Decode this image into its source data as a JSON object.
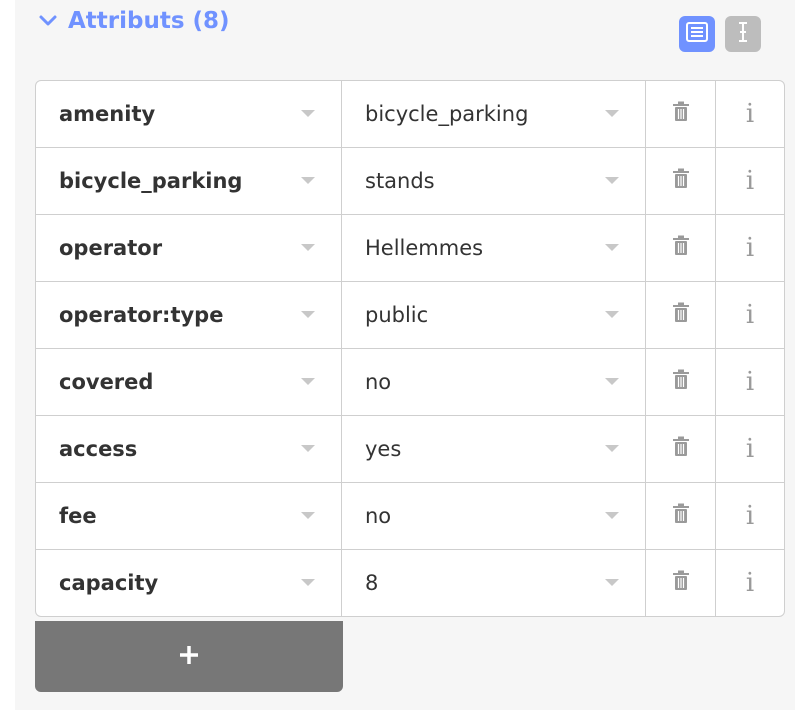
{
  "section": {
    "title": "Attributs (8)",
    "accent_color": "#7092ff",
    "expanded": true,
    "icon": "chevron-down-icon"
  },
  "view_toggles": [
    {
      "name": "list-view-icon",
      "active": true
    },
    {
      "name": "text-view-icon",
      "active": false
    }
  ],
  "tags": [
    {
      "key": "amenity",
      "value": "bicycle_parking"
    },
    {
      "key": "bicycle_parking",
      "value": "stands"
    },
    {
      "key": "operator",
      "value": "Hellemmes"
    },
    {
      "key": "operator:type",
      "value": "public"
    },
    {
      "key": "covered",
      "value": "no"
    },
    {
      "key": "access",
      "value": "yes"
    },
    {
      "key": "fee",
      "value": "no"
    },
    {
      "key": "capacity",
      "value": "8"
    }
  ],
  "row_icons": {
    "delete": "trash-icon",
    "info": "info-icon",
    "info_glyph": "i"
  },
  "add_button": {
    "label": "+",
    "icon": "plus-icon"
  }
}
